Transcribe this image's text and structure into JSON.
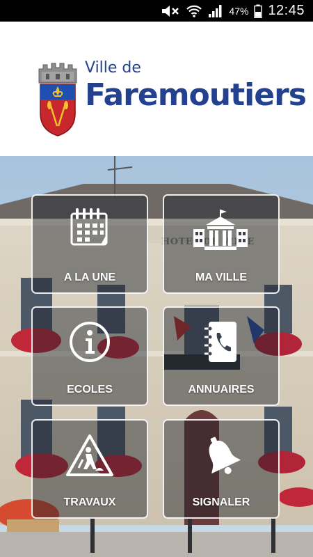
{
  "status_bar": {
    "battery": "47%",
    "time": "12:45"
  },
  "header": {
    "logo_line1": "Ville de",
    "logo_line2": "Faremoutiers"
  },
  "background": {
    "building_sign": "HOTEL DE VILLE"
  },
  "tiles": [
    {
      "label": "A LA UNE",
      "icon": "calendar-icon"
    },
    {
      "label": "MA VILLE",
      "icon": "town-hall-icon"
    },
    {
      "label": "ECOLES",
      "icon": "info-icon"
    },
    {
      "label": "ANNUAIRES",
      "icon": "phone-book-icon"
    },
    {
      "label": "TRAVAUX",
      "icon": "roadwork-icon"
    },
    {
      "label": "SIGNALER",
      "icon": "bell-icon"
    }
  ],
  "colors": {
    "brand_blue": "#24418f",
    "tile_border": "#ffffff"
  }
}
